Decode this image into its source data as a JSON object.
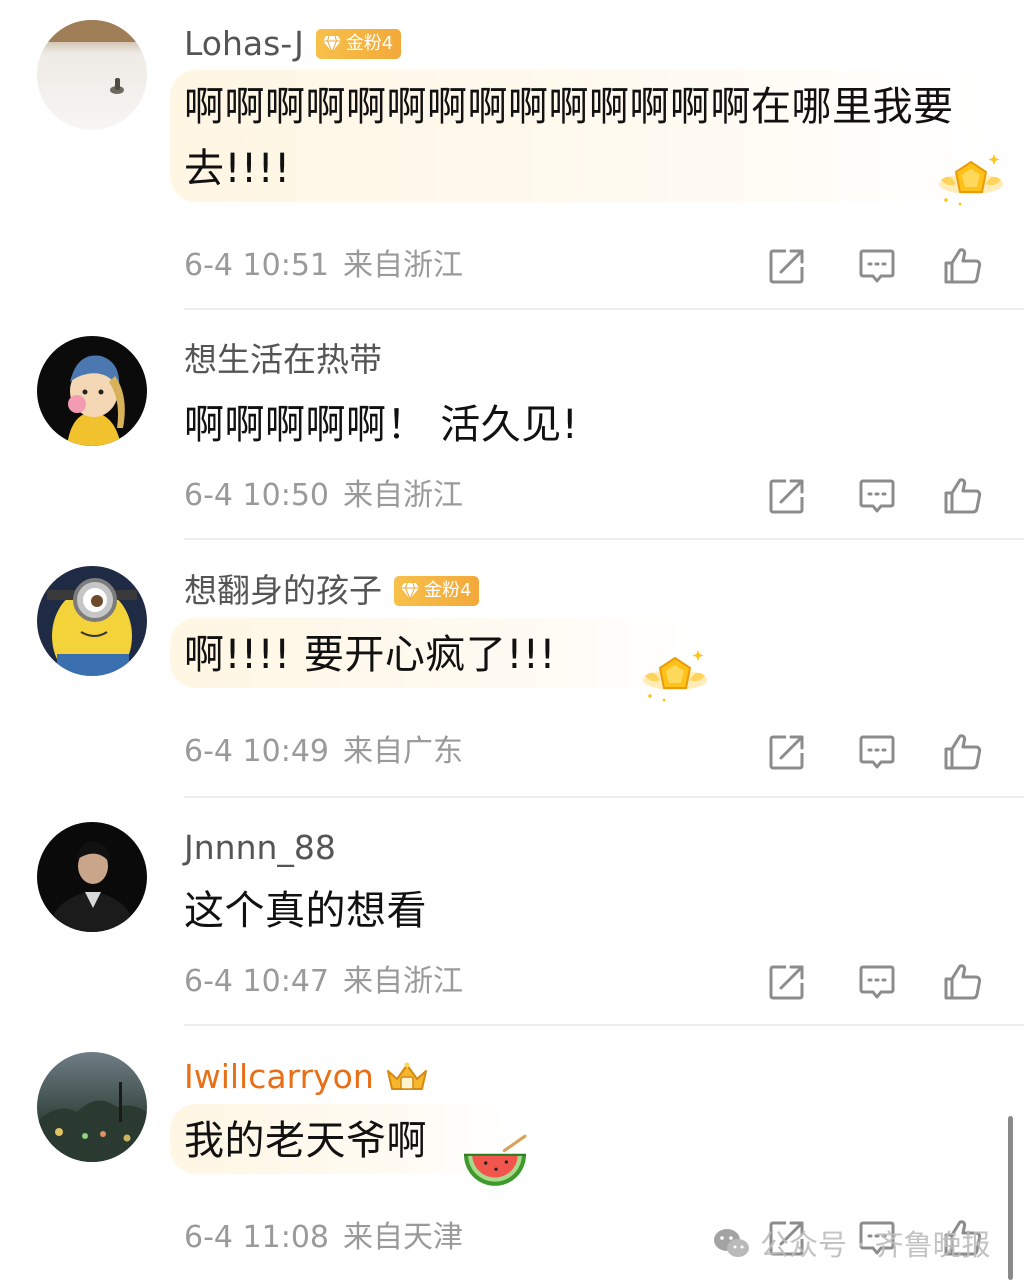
{
  "comments": [
    {
      "username": "Lohas-J",
      "badge": "金粉4",
      "text": "啊啊啊啊啊啊啊啊啊啊啊啊啊啊在哪里我要去!!!!",
      "time": "6-4 10:51",
      "location": "来自浙江"
    },
    {
      "username": "想生活在热带",
      "text": "啊啊啊啊啊！ 活久见!",
      "time": "6-4 10:50",
      "location": "来自浙江"
    },
    {
      "username": "想翻身的孩子",
      "badge": "金粉4",
      "text": "啊!!!! 要开心疯了!!!",
      "time": "6-4 10:49",
      "location": "来自广东"
    },
    {
      "username": "Jnnnn_88",
      "text": "这个真的想看",
      "time": "6-4 10:47",
      "location": "来自浙江"
    },
    {
      "username": "Iwillcarryon",
      "text": "我的老天爷啊",
      "time": "6-4 11:08",
      "location": "来自天津"
    }
  ],
  "icons": {
    "share": "share-icon",
    "reply": "comment-icon",
    "like": "thumbs-up-icon",
    "badge": "gem-icon",
    "crown": "crown-icon",
    "watermark": "wechat-icon"
  },
  "colors": {
    "vip_name": "#e96f16",
    "badge": "#f3a93a",
    "meta": "#9a9a9a"
  },
  "watermark": {
    "text": "公众号 · 齐鲁晚报"
  }
}
